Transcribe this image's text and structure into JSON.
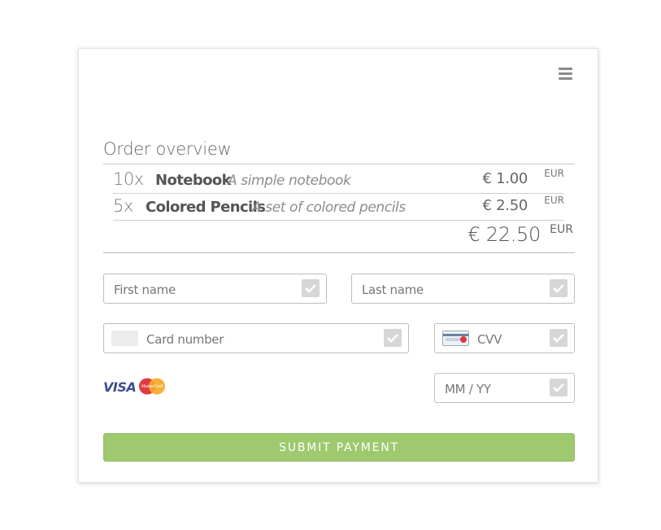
{
  "order": {
    "title": "Order overview",
    "items": [
      {
        "qty": "10x",
        "name": "Notebook",
        "desc": "A simple notebook",
        "price": "€ 1.00",
        "currency": "EUR"
      },
      {
        "qty": "5x",
        "name": "Colored Pencils",
        "desc": "A set of colored pencils",
        "price": "€ 2.50",
        "currency": "EUR"
      }
    ],
    "total": "€ 22.50",
    "total_currency": "EUR"
  },
  "form": {
    "first_name": {
      "placeholder": "First name"
    },
    "last_name": {
      "placeholder": "Last name"
    },
    "card_number": {
      "placeholder": "Card number"
    },
    "cvv": {
      "placeholder": "CVV"
    },
    "expiry": {
      "placeholder": "MM / YY"
    }
  },
  "logos": {
    "visa": "VISA",
    "mastercard": "MasterCard"
  },
  "submit": {
    "label": "SUBMIT PAYMENT"
  },
  "colors": {
    "accent": "#9ec96e",
    "check": "#d6d6d6"
  },
  "icons": [
    "menu-icon",
    "check-icon",
    "card-placeholder-icon",
    "cvv-card-icon",
    "visa-logo",
    "mastercard-logo"
  ]
}
